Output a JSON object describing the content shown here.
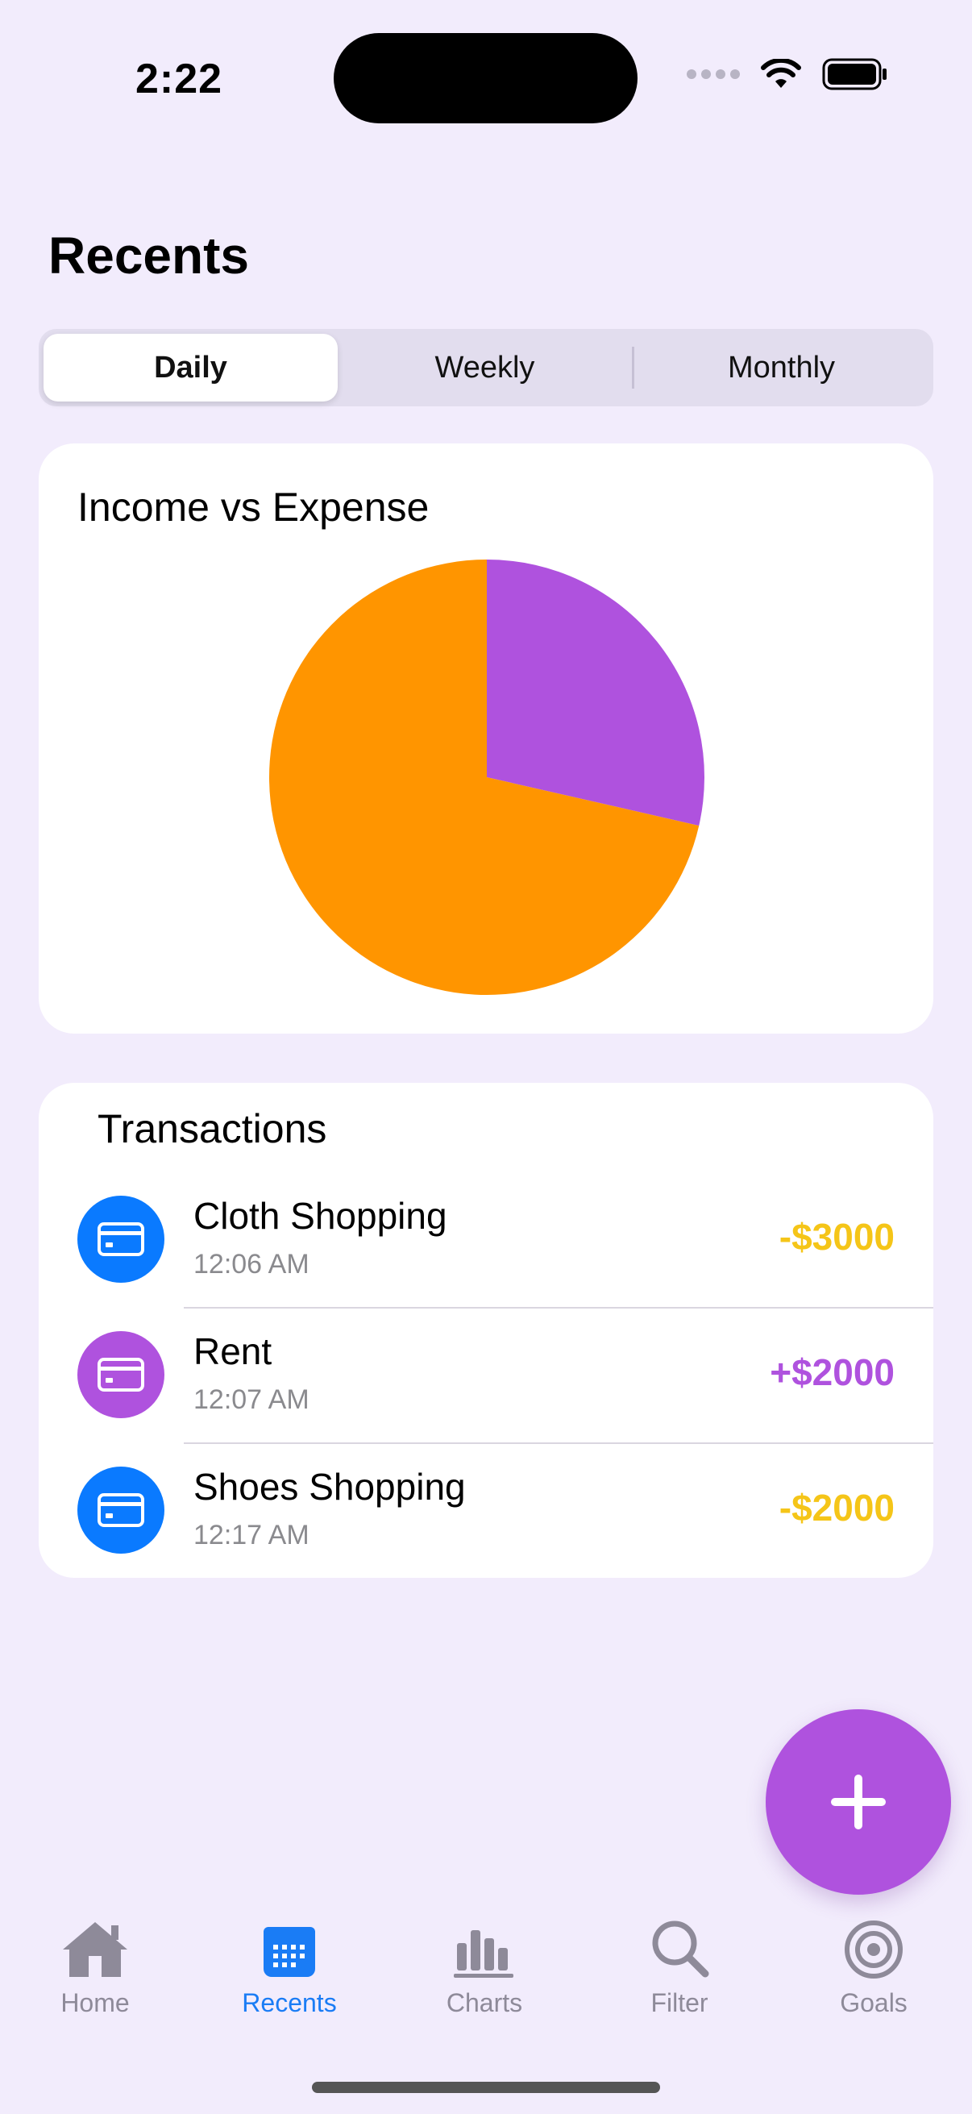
{
  "status_bar": {
    "time": "2:22"
  },
  "header": {
    "title": "Recents"
  },
  "segments": [
    {
      "label": "Daily",
      "active": true
    },
    {
      "label": "Weekly",
      "active": false
    },
    {
      "label": "Monthly",
      "active": false
    }
  ],
  "chart_card": {
    "title": "Income vs Expense"
  },
  "chart_data": {
    "type": "pie",
    "slices": [
      {
        "value": 2000,
        "color": "#AF52DE"
      },
      {
        "value": 5000,
        "color": "#FF9500"
      }
    ]
  },
  "transactions": {
    "title": "Transactions",
    "items": [
      {
        "name": "Cloth Shopping",
        "time": "12:06 AM",
        "amount": "-$3000",
        "icon": "credit-card-icon",
        "icon_color": "#0A7AFF",
        "amount_color": "#F5C518"
      },
      {
        "name": "Rent",
        "time": "12:07 AM",
        "amount": "+$2000",
        "icon": "credit-card-icon",
        "icon_color": "#AF52DE",
        "amount_color": "#AF52DE"
      },
      {
        "name": "Shoes Shopping",
        "time": "12:17 AM",
        "amount": "-$2000",
        "icon": "credit-card-icon",
        "icon_color": "#0A7AFF",
        "amount_color": "#F5C518"
      }
    ]
  },
  "tab_bar": {
    "items": [
      {
        "label": "Home",
        "icon": "house-icon",
        "active": false
      },
      {
        "label": "Recents",
        "icon": "calendar-icon",
        "active": true
      },
      {
        "label": "Charts",
        "icon": "bar-chart-icon",
        "active": false
      },
      {
        "label": "Filter",
        "icon": "search-icon",
        "active": false
      },
      {
        "label": "Goals",
        "icon": "target-icon",
        "active": false
      }
    ]
  },
  "colors": {
    "background": "#F2ECFC",
    "accent": "#AF52DE",
    "active_tab": "#1A7CF5",
    "inactive_tab": "#8E8A99"
  }
}
